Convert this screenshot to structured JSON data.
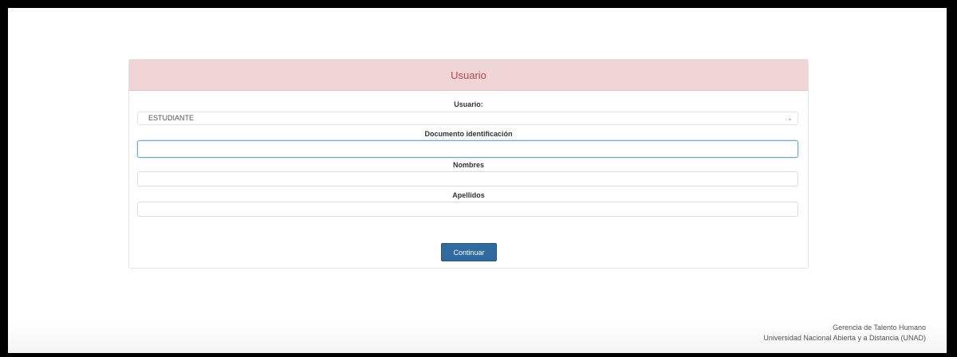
{
  "card": {
    "title": "Usuario",
    "usuario_label": "Usuario:",
    "usuario_value": "ESTUDIANTE",
    "documento_label": "Documento identificación",
    "nombres_label": "Nombres",
    "apellidos_label": "Apellidos",
    "continue_button": "Continuar"
  },
  "footer": {
    "line1": "Gerencia de Talento Humano",
    "line2": "Universidad Nacional Abierta y a Distancia (UNAD)"
  },
  "icons": {
    "select_caret": "chevron-down-icon"
  }
}
